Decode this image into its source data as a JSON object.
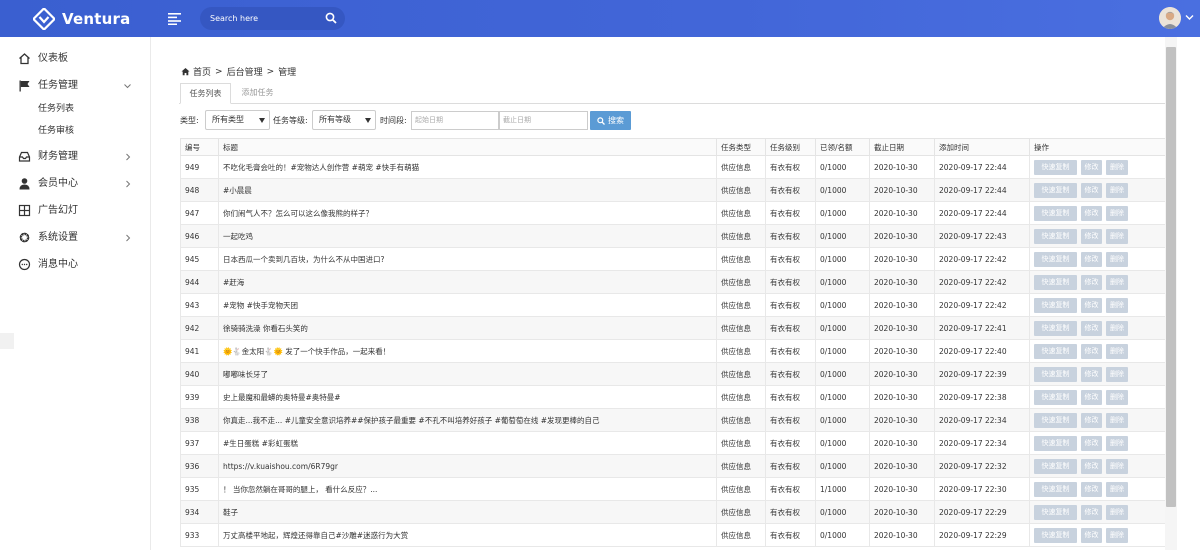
{
  "header": {
    "brand": "Ventura",
    "search_placeholder": "Search here"
  },
  "sidebar": {
    "items": [
      {
        "label": "仪表板",
        "icon": "home-icon"
      },
      {
        "label": "任务管理",
        "icon": "flag-icon"
      },
      {
        "label": "财务管理",
        "icon": "inbox-icon"
      },
      {
        "label": "会员中心",
        "icon": "user-icon"
      },
      {
        "label": "广告幻灯",
        "icon": "grid-icon"
      },
      {
        "label": "系统设置",
        "icon": "gear-icon"
      },
      {
        "label": "消息中心",
        "icon": "message-icon"
      }
    ],
    "subitems": [
      "任务列表",
      "任务审核"
    ]
  },
  "breadcrumb": {
    "home": "首页",
    "sep1": ">",
    "mid": "后台管理",
    "sep2": ">",
    "last": "管理"
  },
  "tabs": [
    "任务列表",
    "添加任务"
  ],
  "filters": {
    "type_label": "类型:",
    "type_value": "所有类型",
    "level_label": "任务等级:",
    "level_value": "所有等级",
    "time_label": "时间段:",
    "start_placeholder": "起始日期",
    "end_placeholder": "截止日期",
    "search_label": "搜索"
  },
  "table": {
    "headers": [
      "编号",
      "标题",
      "任务类型",
      "任务级别",
      "已领/名额",
      "截止日期",
      "添加时间",
      "操作"
    ],
    "actions": [
      "快速复制",
      "修改",
      "删除"
    ],
    "rows": [
      [
        "949",
        "不吃化毛膏会吐的！#宠物达人创作营 #萌宠 #快手有萌猫",
        "供应信息",
        "有衣有权",
        "0/1000",
        "2020-10-30",
        "2020-09-17 22:44"
      ],
      [
        "948",
        "#小晨晨",
        "供应信息",
        "有衣有权",
        "0/1000",
        "2020-10-30",
        "2020-09-17 22:44"
      ],
      [
        "947",
        "你们闹气人不？怎么可以这么像我熊的样子？",
        "供应信息",
        "有衣有权",
        "0/1000",
        "2020-10-30",
        "2020-09-17 22:44"
      ],
      [
        "946",
        "一起吃鸡",
        "供应信息",
        "有衣有权",
        "0/1000",
        "2020-10-30",
        "2020-09-17 22:43"
      ],
      [
        "945",
        "日本西瓜一个卖到几百块，为什么不从中国进口?",
        "供应信息",
        "有衣有权",
        "0/1000",
        "2020-10-30",
        "2020-09-17 22:42"
      ],
      [
        "944",
        "#赶海",
        "供应信息",
        "有衣有权",
        "0/1000",
        "2020-10-30",
        "2020-09-17 22:42"
      ],
      [
        "943",
        "#宠物 #快手宠物天团",
        "供应信息",
        "有衣有权",
        "0/1000",
        "2020-10-30",
        "2020-09-17 22:42"
      ],
      [
        "942",
        "徐骑骑洗澡 你看石头笑的",
        "供应信息",
        "有衣有权",
        "0/1000",
        "2020-10-30",
        "2020-09-17 22:41"
      ],
      [
        "941",
        "🌞🐇金太阳🐇🌞 发了一个快手作品，一起来看！",
        "供应信息",
        "有衣有权",
        "0/1000",
        "2020-10-30",
        "2020-09-17 22:40"
      ],
      [
        "940",
        "嘟嘟味长牙了",
        "供应信息",
        "有衣有权",
        "0/1000",
        "2020-10-30",
        "2020-09-17 22:39"
      ],
      [
        "939",
        "史上最魔和最蟒的奥特曼#奥特曼#",
        "供应信息",
        "有衣有权",
        "0/1000",
        "2020-10-30",
        "2020-09-17 22:38"
      ],
      [
        "938",
        "你真走...我不走... #儿童安全意识培养##保护孩子最重要 #不孔不叫培养好孩子 #葡萄萄在线 #发现更棒的自己",
        "供应信息",
        "有衣有权",
        "0/1000",
        "2020-10-30",
        "2020-09-17 22:34"
      ],
      [
        "937",
        "#生日蛋糕 #彩虹蛋糕",
        "供应信息",
        "有衣有权",
        "0/1000",
        "2020-10-30",
        "2020-09-17 22:34"
      ],
      [
        "936",
        "https://v.kuaishou.com/6R79gr",
        "供应信息",
        "有衣有权",
        "0/1000",
        "2020-10-30",
        "2020-09-17 22:32"
      ],
      [
        "935",
        "！ 当你忽然躺在哥哥的腿上， 看什么反应？...",
        "供应信息",
        "有衣有权",
        "1/1000",
        "2020-10-30",
        "2020-09-17 22:30"
      ],
      [
        "934",
        "鞋子",
        "供应信息",
        "有衣有权",
        "0/1000",
        "2020-10-30",
        "2020-09-17 22:29"
      ],
      [
        "933",
        "万丈高楼平地起，辉煌还得靠自己#沙雕#迷惑行为大赏",
        "供应信息",
        "有衣有权",
        "0/1000",
        "2020-10-30",
        "2020-09-17 22:29"
      ]
    ]
  }
}
